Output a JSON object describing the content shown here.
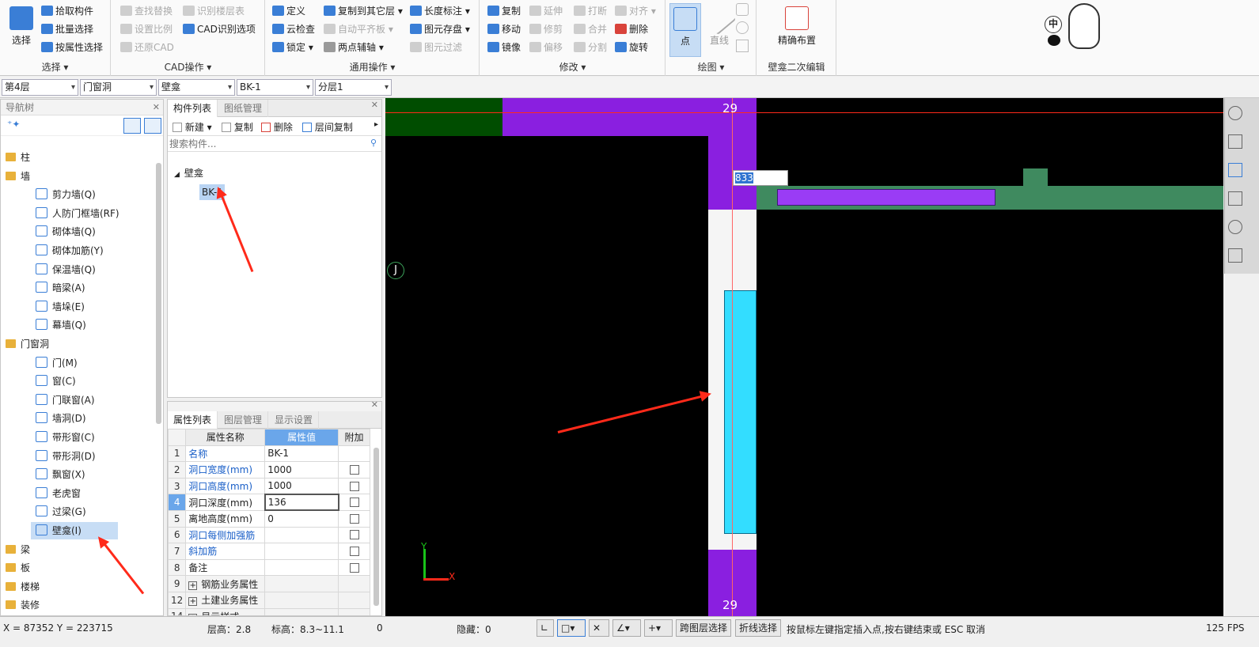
{
  "ribbon": {
    "select": {
      "big": "选择",
      "items": [
        "拾取构件",
        "批量选择",
        "按属性选择"
      ],
      "group": "选择 ▾"
    },
    "cad": {
      "items": [
        "查找替换",
        "设置比例",
        "还原CAD",
        "识别楼层表",
        "CAD识别选项"
      ],
      "group": "CAD操作 ▾"
    },
    "general": {
      "items": [
        "定义",
        "云检查",
        "锁定 ▾",
        "复制到其它层 ▾",
        "自动平齐板 ▾",
        "两点辅轴 ▾",
        "长度标注 ▾",
        "图元存盘 ▾",
        "图元过滤"
      ],
      "group": "通用操作 ▾"
    },
    "modify": {
      "items": [
        "复制",
        "移动",
        "镜像",
        "延伸",
        "修剪",
        "偏移",
        "打断",
        "合并",
        "分割",
        "对齐 ▾",
        "删除",
        "旋转"
      ],
      "group": "修改 ▾"
    },
    "draw": {
      "items": [
        "点",
        "直线"
      ],
      "group": "绘图 ▾"
    },
    "niche": {
      "big": "精确布置",
      "group": "壁龛二次编辑"
    }
  },
  "toolbar": {
    "floor": "第4层",
    "category": "门窗洞",
    "type": "壁龛",
    "component": "BK-1",
    "layer": "分层1"
  },
  "nav": {
    "title": "导航树",
    "items": [
      "柱",
      "墙",
      "剪力墙(Q)",
      "人防门框墙(RF)",
      "砌体墙(Q)",
      "砌体加筋(Y)",
      "保温墙(Q)",
      "暗梁(A)",
      "墙垛(E)",
      "幕墙(Q)",
      "门窗洞",
      "门(M)",
      "窗(C)",
      "门联窗(A)",
      "墙洞(D)",
      "带形窗(C)",
      "带形洞(D)",
      "飘窗(X)",
      "老虎窗",
      "过梁(G)",
      "壁龛(I)",
      "梁",
      "板",
      "楼梯",
      "装修"
    ]
  },
  "comp": {
    "tab1": "构件列表",
    "tab2": "图纸管理",
    "new": "新建 ▾",
    "copy": "复制",
    "del": "删除",
    "floorcopy": "层间复制",
    "search": "搜索构件...",
    "group": "壁龛",
    "item": "BK-1"
  },
  "props": {
    "tab1": "属性列表",
    "tab2": "图层管理",
    "tab3": "显示设置",
    "h_name": "属性名称",
    "h_val": "属性值",
    "h_add": "附加",
    "rows": [
      [
        "1",
        "名称",
        "BK-1"
      ],
      [
        "2",
        "洞口宽度(mm)",
        "1000"
      ],
      [
        "3",
        "洞口高度(mm)",
        "1000"
      ],
      [
        "4",
        "洞口深度(mm)",
        "136"
      ],
      [
        "5",
        "离地高度(mm)",
        "0"
      ],
      [
        "6",
        "洞口每侧加强筋",
        ""
      ],
      [
        "7",
        "斜加筋",
        ""
      ],
      [
        "8",
        "备注",
        ""
      ],
      [
        "9",
        "钢筋业务属性",
        ""
      ],
      [
        "12",
        "土建业务属性",
        ""
      ],
      [
        "14",
        "显示样式",
        ""
      ]
    ]
  },
  "canvas": {
    "axis_top": "29",
    "axis_bottom": "29",
    "axis_left": "J",
    "dim_input": "833",
    "y": "Y",
    "x": "X"
  },
  "status": {
    "coords": "X = 87352 Y = 223715",
    "floor_h": "层高：2.8",
    "elev": "标高：8.3~11.1",
    "zero": "0",
    "hidden": "隐藏：0",
    "btn1": "跨图层选择",
    "btn2": "折线选择",
    "hint": "按鼠标左键指定插入点,按右键结束或 ESC 取消",
    "fps": "125 FPS"
  },
  "ime": {
    "label": "中"
  }
}
